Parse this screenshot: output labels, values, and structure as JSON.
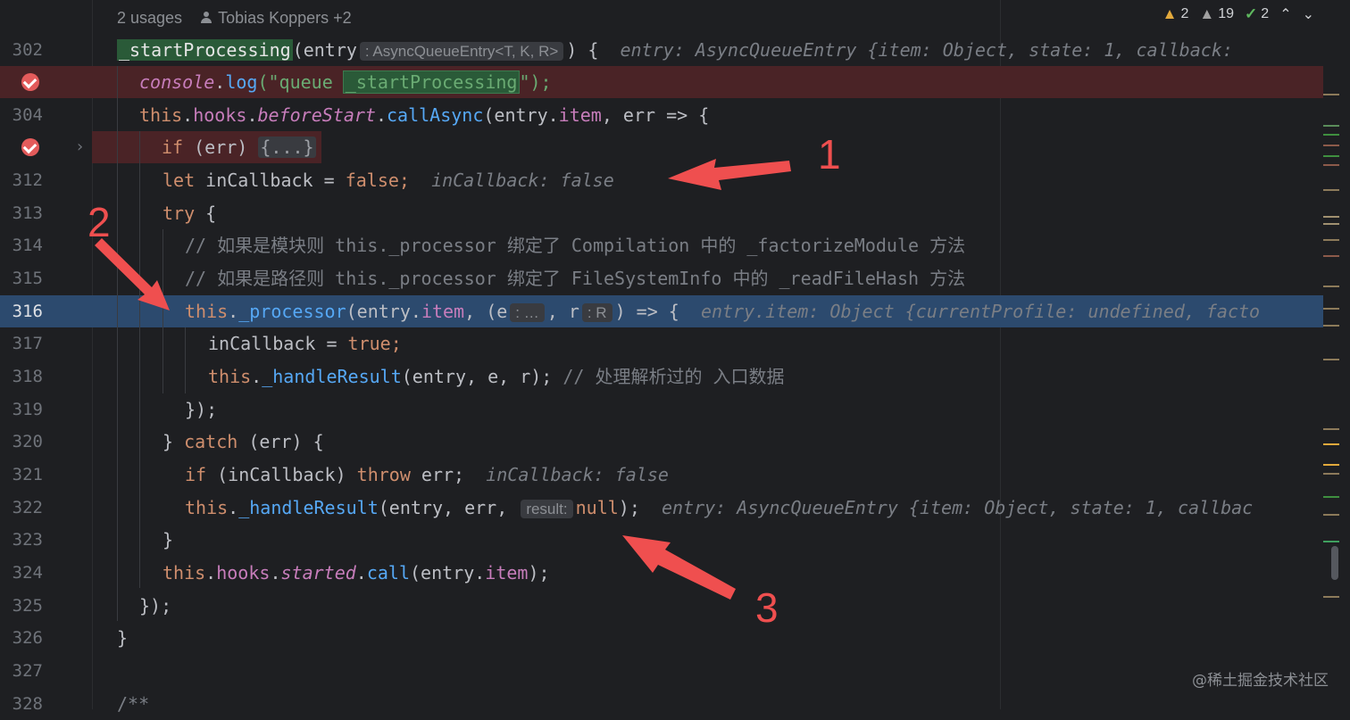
{
  "header": {
    "usages": "2 usages",
    "author": "Tobias Koppers +2"
  },
  "inspections": {
    "warnings": "2",
    "weak_warnings": "19",
    "ok": "2",
    "prev_label": "⌃",
    "next_label": "⌄"
  },
  "lines": [
    {
      "num": "302",
      "prefix": "_startProcessing",
      "t1": "(entry",
      "inlay": ": AsyncQueueEntry<T, K, R>",
      "t2": ") {",
      "hint": "entry: AsyncQueueEntry {item: Object, state: 1, callback:"
    },
    {
      "num": "",
      "a": "console",
      "b": ".",
      "c": "log",
      "d": "(\"queue ",
      "e": "_startProcessing",
      "f": "\");"
    },
    {
      "num": "304",
      "a": "this",
      "b": ".",
      "c": "hooks",
      "d": ".",
      "e": "beforeStart",
      "f": ".",
      "g": "callAsync",
      "h": "(entry.",
      "i": "item",
      "j": ", err => {"
    },
    {
      "num": "",
      "a": "if",
      "b": " (err) ",
      "c": "{...}"
    },
    {
      "num": "312",
      "a": "let",
      "b": " inCallback = ",
      "c": "false",
      "d": ";",
      "hint": "inCallback: false"
    },
    {
      "num": "313",
      "a": "try",
      "b": " {"
    },
    {
      "num": "314",
      "a": "// 如果是模块则 this._processor 绑定了 Compilation 中的 _factorizeModule 方法"
    },
    {
      "num": "315",
      "a": "// 如果是路径则 this._processor 绑定了 FileSystemInfo 中的 _readFileHash 方法"
    },
    {
      "num": "316",
      "a": "this",
      "b": ".",
      "c": "_processor",
      "d": "(entry.",
      "e": "item",
      "f": ", (e",
      "inlay1": ": …",
      "g": ", r",
      "inlay2": ": R",
      "h": ") => {",
      "hint": "entry.item: Object {currentProfile: undefined, facto"
    },
    {
      "num": "317",
      "a": "inCallback = ",
      "b": "true",
      "c": ";"
    },
    {
      "num": "318",
      "a": "this",
      "b": ".",
      "c": "_handleResult",
      "d": "(entry, e, r); ",
      "e": "// 处理解析过的 入口数据"
    },
    {
      "num": "319",
      "a": "});"
    },
    {
      "num": "320",
      "a": "} ",
      "b": "catch",
      "c": " (err) {"
    },
    {
      "num": "321",
      "a": "if",
      "b": " (inCallback) ",
      "c": "throw",
      "d": " err;",
      "hint": "inCallback: false"
    },
    {
      "num": "322",
      "a": "this",
      "b": ".",
      "c": "_handleResult",
      "d": "(entry, err, ",
      "inlay": "result:",
      "e": "null",
      "f": ");",
      "hint": "entry: AsyncQueueEntry {item: Object, state: 1, callbac"
    },
    {
      "num": "323",
      "a": "}"
    },
    {
      "num": "324",
      "a": "this",
      "b": ".",
      "c": "hooks",
      "d": ".",
      "e": "started",
      "f": ".",
      "g": "call",
      "h": "(entry.",
      "i": "item",
      "j": ");"
    },
    {
      "num": "325",
      "a": "});"
    },
    {
      "num": "326",
      "a": "}"
    },
    {
      "num": "327",
      "a": ""
    },
    {
      "num": "328",
      "a": "/**"
    }
  ],
  "annotations": [
    "1",
    "2",
    "3"
  ],
  "watermark": "@稀土掘金技术社区",
  "colors": {
    "arrow": "#ef4f4f",
    "error_line": "#4a2326",
    "current_line": "#2c4a6e"
  },
  "icons": [
    "user-icon",
    "warning-icon",
    "weak-warning-icon",
    "check-icon",
    "breakpoint-icon",
    "fold-arrow-icon"
  ]
}
